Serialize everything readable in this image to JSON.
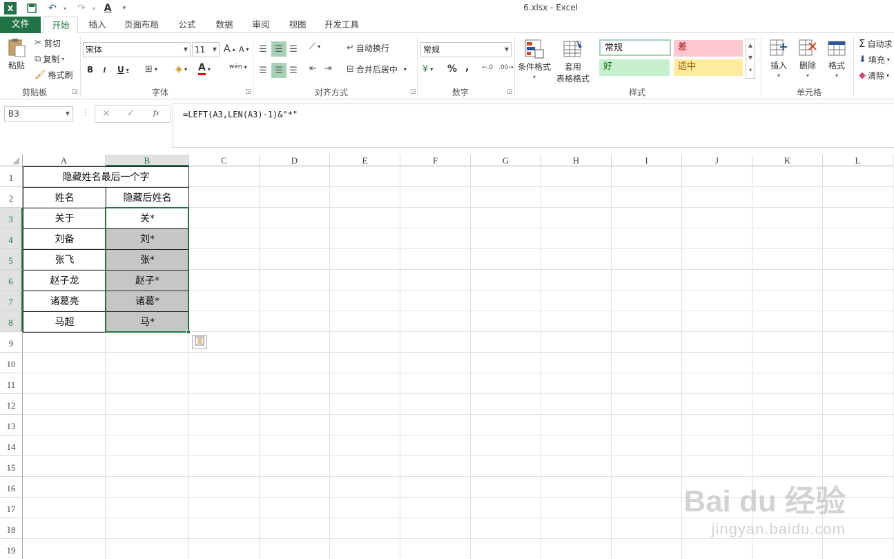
{
  "window": {
    "title": "6.xlsx - Excel"
  },
  "quick_access": {
    "icons": [
      "excel-logo-icon",
      "save-icon",
      "undo-icon",
      "redo-icon",
      "font-color-icon",
      "customize-icon"
    ]
  },
  "tabs": [
    {
      "label": "文件"
    },
    {
      "label": "开始"
    },
    {
      "label": "插入"
    },
    {
      "label": "页面布局"
    },
    {
      "label": "公式"
    },
    {
      "label": "数据"
    },
    {
      "label": "审阅"
    },
    {
      "label": "视图"
    },
    {
      "label": "开发工具"
    }
  ],
  "ribbon": {
    "clipboard": {
      "label": "剪贴板",
      "paste": "粘贴",
      "cut": "剪切",
      "copy": "复制",
      "format_painter": "格式刷"
    },
    "font": {
      "label": "字体",
      "font_name": "宋体",
      "font_size": "11",
      "grow": "A",
      "shrink": "A",
      "bold": "B",
      "italic": "I",
      "underline": "U",
      "font_color": "A",
      "phonetic": "wén"
    },
    "alignment": {
      "label": "对齐方式",
      "wrap_text": "自动换行",
      "merge_center": "合并后居中"
    },
    "number": {
      "label": "数字",
      "format": "常规",
      "percent": "%",
      "comma": ","
    },
    "styles": {
      "label": "样式",
      "conditional": "条件格式",
      "table_format_1": "套用",
      "table_format_2": "表格格式",
      "normal": "常规",
      "bad": "差",
      "good": "好",
      "neutral": "适中"
    },
    "cells": {
      "label": "单元格",
      "insert": "插入",
      "delete": "删除",
      "format": "格式"
    },
    "editing": {
      "autosum": "自动求",
      "fill": "填充",
      "clear": "清除"
    }
  },
  "formula_bar": {
    "name_box": "B3",
    "formula": "=LEFT(A3,LEN(A3)-1)&\"*\"",
    "fx": "fx"
  },
  "columns": [
    "A",
    "B",
    "C",
    "D",
    "E",
    "F",
    "G",
    "H",
    "I",
    "J",
    "K",
    "L"
  ],
  "rows": [
    "1",
    "2",
    "3",
    "4",
    "5",
    "6",
    "7",
    "8",
    "9",
    "10",
    "11",
    "12",
    "13",
    "14",
    "15",
    "16",
    "17",
    "18",
    "19"
  ],
  "sheet": {
    "title": "隐藏姓名最后一个字",
    "header_a": "姓名",
    "header_b": "隐藏后姓名",
    "data": [
      {
        "a": "关于",
        "b": "关*"
      },
      {
        "a": "刘备",
        "b": "刘*"
      },
      {
        "a": "张飞",
        "b": "张*"
      },
      {
        "a": "赵子龙",
        "b": "赵子*"
      },
      {
        "a": "诸葛亮",
        "b": "诸葛*"
      },
      {
        "a": "马超",
        "b": "马*"
      }
    ]
  },
  "watermark": {
    "brand": "Bai du 经验",
    "url": "jingyan.baidu.com"
  },
  "colors": {
    "accent": "#217346",
    "bad_bg": "#ffc7ce",
    "bad_fg": "#9c0006",
    "good_bg": "#c6efce",
    "good_fg": "#006100",
    "neutral_bg": "#ffeb9c",
    "neutral_fg": "#9c5700",
    "selection_fill": "#c6c6c6"
  }
}
